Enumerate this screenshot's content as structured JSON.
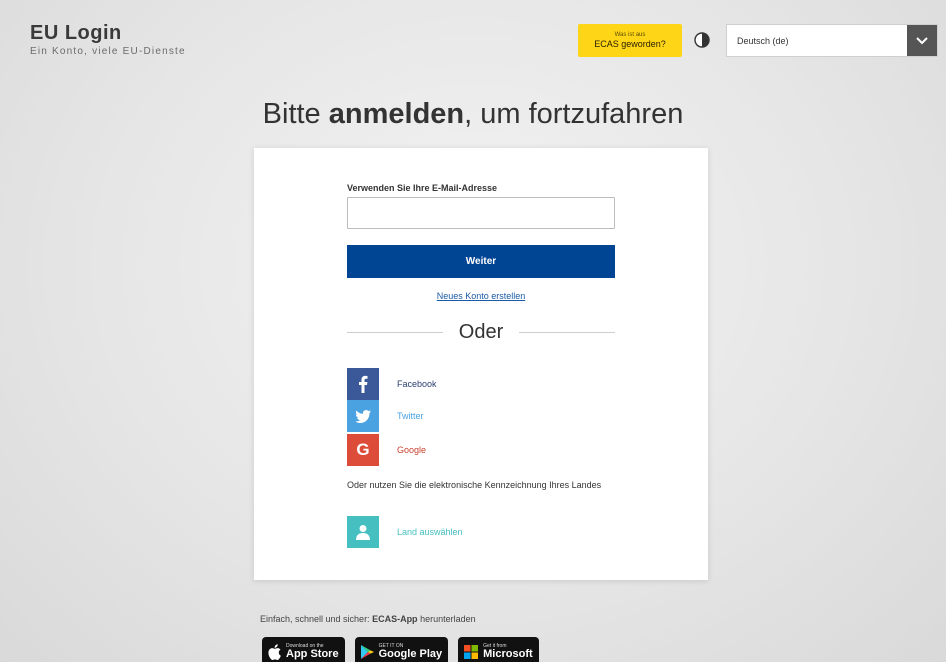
{
  "header": {
    "brand_title": "EU Login",
    "brand_subtitle": "Ein Konto, viele EU-Dienste",
    "ecas_small": "Was ist aus",
    "ecas_main": "ECAS geworden?",
    "language_value": "Deutsch (de)"
  },
  "headline": {
    "prefix": "Bitte ",
    "bold": "anmelden",
    "suffix": ", um fortzufahren"
  },
  "login": {
    "email_label": "Verwenden Sie Ihre E-Mail-Adresse",
    "email_value": "",
    "next_label": "Weiter",
    "new_account_label": "Neues Konto erstellen",
    "or_label": "Oder"
  },
  "social": [
    {
      "label": "Facebook",
      "icon": "facebook-icon",
      "color": "#3b5998",
      "text_color": "#2a3f70"
    },
    {
      "label": "Twitter",
      "icon": "twitter-icon",
      "color": "#4aa2e0",
      "text_color": "#4aa2e0"
    },
    {
      "label": "Google",
      "icon": "google-icon",
      "color": "#dd4b39",
      "text_color": "#c9402f"
    }
  ],
  "eid": {
    "text": "Oder nutzen Sie die elektronische Kennzeichnung Ihres Landes",
    "select_label": "Land auswählen",
    "icon": "person-icon",
    "color": "#45bfc0"
  },
  "footer": {
    "text_prefix": "Einfach, schnell und sicher: ",
    "text_bold": "ECAS-App",
    "text_suffix": " herunterladen",
    "badges": [
      {
        "small": "Download on the",
        "name": "App Store",
        "icon": "apple-icon"
      },
      {
        "small": "GET IT ON",
        "name": "Google Play",
        "icon": "google-play-icon"
      },
      {
        "small": "Get it from",
        "name": "Microsoft",
        "icon": "windows-icon"
      }
    ]
  },
  "colors": {
    "accent_blue": "#004494",
    "ecas_yellow": "#ffd617",
    "link_blue": "#1a5aa8"
  }
}
